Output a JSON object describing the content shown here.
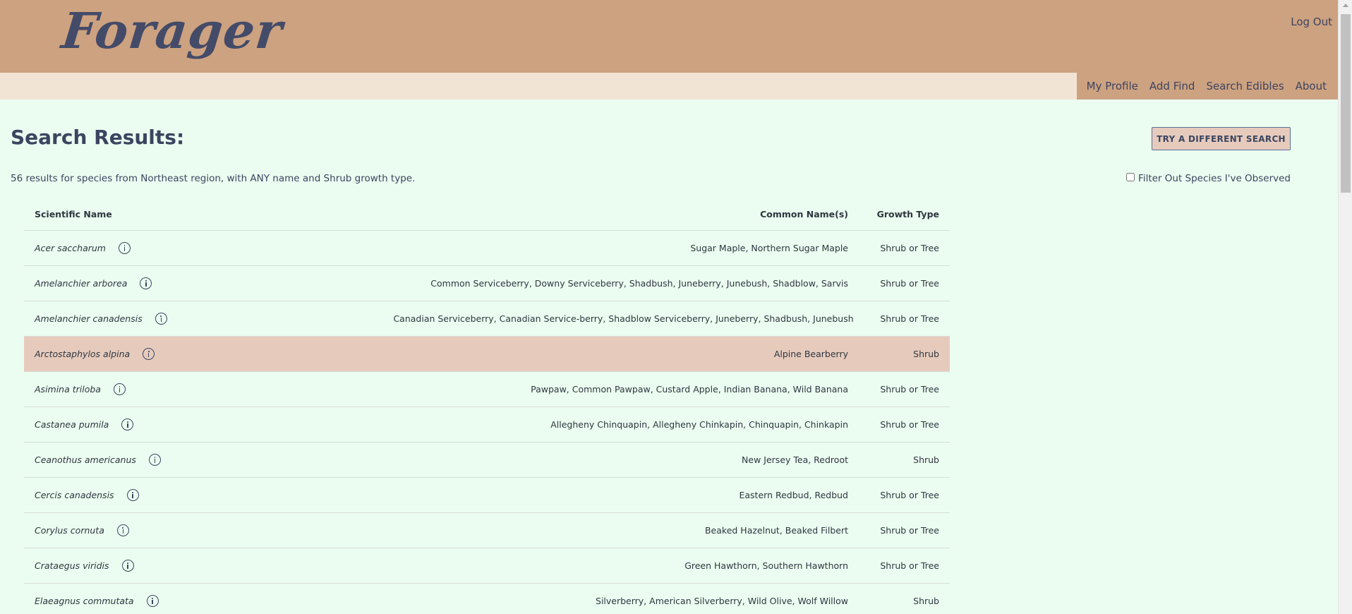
{
  "header": {
    "logo": "Forager",
    "logout_label": "Log Out"
  },
  "nav": {
    "items": [
      "My Profile",
      "Add Find",
      "Search Edibles",
      "About"
    ]
  },
  "main": {
    "title": "Search Results:",
    "try_button_label": "TRY A DIFFERENT SEARCH",
    "summary": "56 results for species from Northeast region, with ANY name and Shrub growth type.",
    "filter_label": "Filter Out Species I've Observed"
  },
  "table": {
    "headers": {
      "scientific": "Scientific Name",
      "common": "Common Name(s)",
      "growth": "Growth Type"
    },
    "rows": [
      {
        "scientific": "Acer saccharum",
        "common": "Sugar Maple, Northern Sugar Maple",
        "growth": "Shrub or Tree"
      },
      {
        "scientific": "Amelanchier arborea",
        "common": "Common Serviceberry, Downy Serviceberry, Shadbush, Juneberry, Junebush, Shadblow, Sarvis",
        "growth": "Shrub or Tree"
      },
      {
        "scientific": "Amelanchier canadensis",
        "common": "Canadian Serviceberry, Canadian Service-berry, Shadblow Serviceberry, Juneberry, Shadbush, Junebush",
        "growth": "Shrub or Tree"
      },
      {
        "scientific": "Arctostaphylos alpina",
        "common": "Alpine Bearberry",
        "growth": "Shrub"
      },
      {
        "scientific": "Asimina triloba",
        "common": "Pawpaw, Common Pawpaw, Custard Apple, Indian Banana, Wild Banana",
        "growth": "Shrub or Tree"
      },
      {
        "scientific": "Castanea pumila",
        "common": "Allegheny Chinquapin, Allegheny Chinkapin, Chinquapin, Chinkapin",
        "growth": "Shrub or Tree"
      },
      {
        "scientific": "Ceanothus americanus",
        "common": "New Jersey Tea, Redroot",
        "growth": "Shrub"
      },
      {
        "scientific": "Cercis canadensis",
        "common": "Eastern Redbud, Redbud",
        "growth": "Shrub or Tree"
      },
      {
        "scientific": "Corylus cornuta",
        "common": "Beaked Hazelnut, Beaked Filbert",
        "growth": "Shrub or Tree"
      },
      {
        "scientific": "Crataegus viridis",
        "common": "Green Hawthorn, Southern Hawthorn",
        "growth": "Shrub or Tree"
      },
      {
        "scientific": "Elaeagnus commutata",
        "common": "Silverberry, American Silverberry, Wild Olive, Wolf Willow",
        "growth": "Shrub"
      }
    ]
  },
  "colors": {
    "header_bg": "#cda280",
    "navbar_bg": "#f2e4d5",
    "page_bg": "#ebfdf0",
    "highlight_row": "#e6cbbd",
    "text": "#3b4560"
  }
}
